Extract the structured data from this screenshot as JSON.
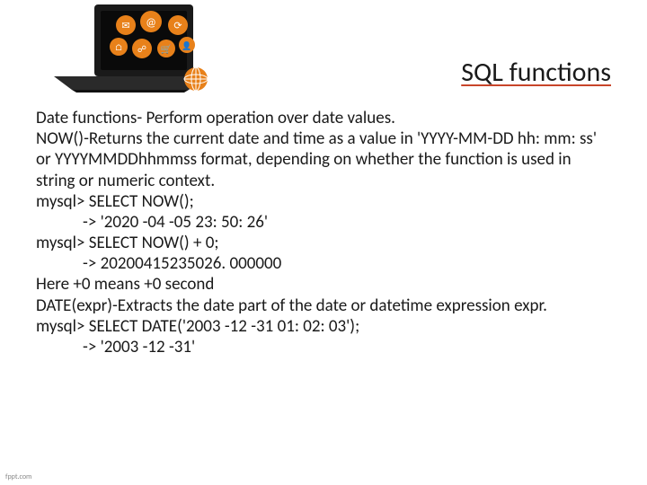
{
  "title": "SQL functions",
  "lines": {
    "l1": "Date functions- Perform operation over date values.",
    "l2": "NOW()-Returns the current date and time as a value in 'YYYY-MM-DD hh: mm: ss' or YYYYMMDDhhmmss format, depending on whether the function is used in string or numeric context.",
    "l3": "mysql> SELECT NOW();",
    "l4": "-> '2020 -04 -05 23: 50: 26'",
    "l5": "mysql> SELECT NOW() + 0;",
    "l6": "-> 20200415235026. 000000",
    "l7": "Here +0 means +0 second",
    "l8": "DATE(expr)-Extracts the date part of the date or datetime expression expr.",
    "l9": "mysql> SELECT DATE('2003 -12 -31 01: 02: 03');",
    "l10": "-> '2003 -12 -31'"
  },
  "footer": "fppt.com"
}
